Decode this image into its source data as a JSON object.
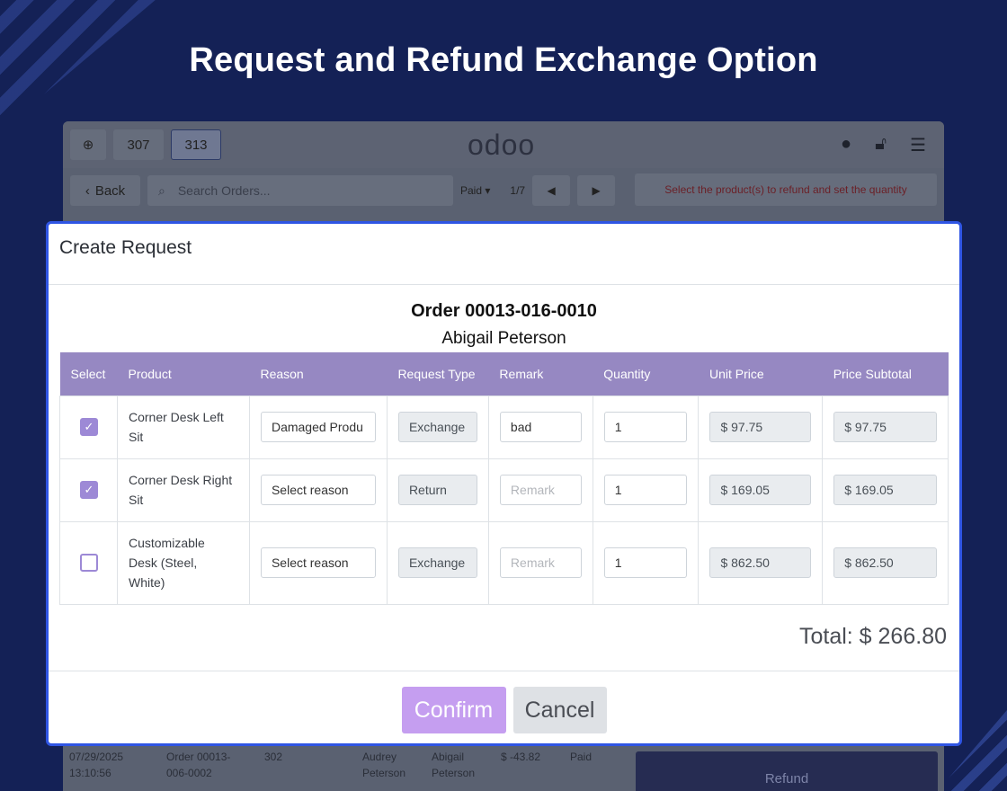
{
  "hero": {
    "title": "Request and Refund Exchange Option"
  },
  "pos": {
    "logo": "odoo",
    "order_buttons": [
      "307",
      "313"
    ],
    "back_label": "Back",
    "search_placeholder": "Search Orders...",
    "filter_label": "Paid",
    "page_indicator": "1/7",
    "hint": "Select the product(s) to refund and set the quantity",
    "bottom_row": {
      "date": "07/29/2025",
      "time": "13:10:56",
      "order": "Order 00013-",
      "order2": "006-0002",
      "table": "302",
      "cashier": "Audrey",
      "cashier2": "Peterson",
      "customer": "Abigail",
      "customer2": "Peterson",
      "amount": "$ -43.82",
      "status": "Paid"
    },
    "refund_label": "Refund"
  },
  "modal": {
    "title": "Create Request",
    "order_title": "Order 00013-016-0010",
    "customer": "Abigail Peterson",
    "columns": [
      "Select",
      "Product",
      "Reason",
      "Request Type",
      "Remark",
      "Quantity",
      "Unit Price",
      "Price Subtotal"
    ],
    "rows": [
      {
        "selected": true,
        "product": "Corner Desk Left Sit",
        "reason": "Damaged Produ",
        "request_type": "Exchange",
        "remark": "bad",
        "remark_placeholder": "",
        "quantity": "1",
        "unit_price": "$ 97.75",
        "subtotal": "$ 97.75"
      },
      {
        "selected": true,
        "product": "Corner Desk Right Sit",
        "reason": "Select reason",
        "request_type": "Return",
        "remark": "",
        "remark_placeholder": "Remark",
        "quantity": "1",
        "unit_price": "$ 169.05",
        "subtotal": "$ 169.05"
      },
      {
        "selected": false,
        "product": "Customizable Desk (Steel, White)",
        "reason": "Select reason",
        "request_type": "Exchange",
        "remark": "",
        "remark_placeholder": "Remark",
        "quantity": "1",
        "unit_price": "$ 862.50",
        "subtotal": "$ 862.50"
      }
    ],
    "total": "Total: $ 266.80",
    "confirm_label": "Confirm",
    "cancel_label": "Cancel"
  }
}
